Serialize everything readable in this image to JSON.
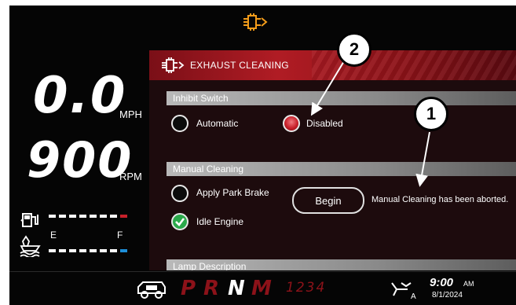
{
  "cluster": {
    "speed_value": "0.0",
    "speed_unit": "MPH",
    "rpm_value": "900",
    "rpm_unit": "RPM",
    "fuel_gauge": {
      "icon": "fuel-pump-icon",
      "level": 0.9,
      "end_color": "#c8202a"
    },
    "def_gauge": {
      "icon": "def-fluid-icon",
      "label_empty": "E",
      "label_full": "F",
      "level": 0.9,
      "end_color": "#1e8fd8"
    }
  },
  "top_status": {
    "icon": "exhaust-filter-icon",
    "color": "#f39c1a"
  },
  "panel": {
    "title": "EXHAUST CLEANING",
    "title_icon": "exhaust-filter-icon",
    "inhibit_section": {
      "header": "Inhibit Switch",
      "options": [
        {
          "label": "Automatic",
          "selected": false
        },
        {
          "label": "Disabled",
          "selected": true
        }
      ]
    },
    "manual_section": {
      "header": "Manual Cleaning",
      "conditions": [
        {
          "label": "Apply Park Brake",
          "met": false
        },
        {
          "label": "Idle Engine",
          "met": true
        }
      ],
      "begin_label": "Begin",
      "status_message": "Manual Cleaning has been aborted."
    },
    "lamp_section": {
      "header": "Lamp Description"
    }
  },
  "callouts": {
    "one": "1",
    "two": "2"
  },
  "bottom_bar": {
    "gears": [
      "P",
      "R",
      "N",
      "M"
    ],
    "active_gear": "N",
    "gear_numbers": "1234",
    "time": "9:00",
    "ampm": "AM",
    "date": "8/1/2024",
    "left_icon": "park-brake-icon",
    "right_icon": "steering-auto-icon"
  },
  "colors": {
    "accent_red": "#b01c24",
    "warning_orange": "#f39c1a",
    "check_green": "#2aa84a"
  }
}
